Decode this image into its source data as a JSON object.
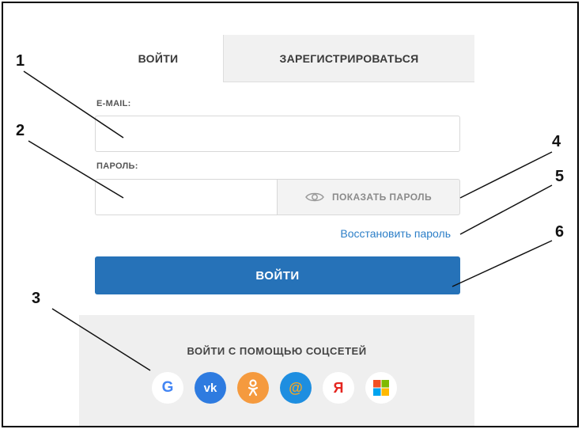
{
  "tabs": {
    "login": "ВОЙТИ",
    "register": "ЗАРЕГИСТРИРОВАТЬСЯ"
  },
  "email": {
    "label": "E-MAIL:",
    "value": "",
    "placeholder": ""
  },
  "password": {
    "label": "ПАРОЛЬ:",
    "value": "",
    "placeholder": "",
    "show_label": "ПОКАЗАТЬ ПАРОЛЬ",
    "show_icon": "eye-icon"
  },
  "restore_link": "Восстановить пароль",
  "submit_label": "ВОЙТИ",
  "social": {
    "title": "ВОЙТИ С ПОМОЩЬЮ СОЦСЕТЕЙ",
    "icons": [
      {
        "name": "google-icon",
        "glyph": "G",
        "color": "#4285f4"
      },
      {
        "name": "vk-icon",
        "glyph": "vk",
        "color": "#2e7be0"
      },
      {
        "name": "odnoklassniki-icon",
        "glyph": "ok",
        "color": "#f59a3e"
      },
      {
        "name": "mailru-icon",
        "glyph": "@",
        "color": "#1e8ee0"
      },
      {
        "name": "yandex-icon",
        "glyph": "Я",
        "color": "#e52620"
      },
      {
        "name": "microsoft-icon",
        "glyph": "ms",
        "color": "#f25022"
      }
    ]
  },
  "callouts": [
    "1",
    "2",
    "3",
    "4",
    "5",
    "6"
  ],
  "colors": {
    "primary": "#2672b8",
    "link": "#2b7ec7"
  }
}
